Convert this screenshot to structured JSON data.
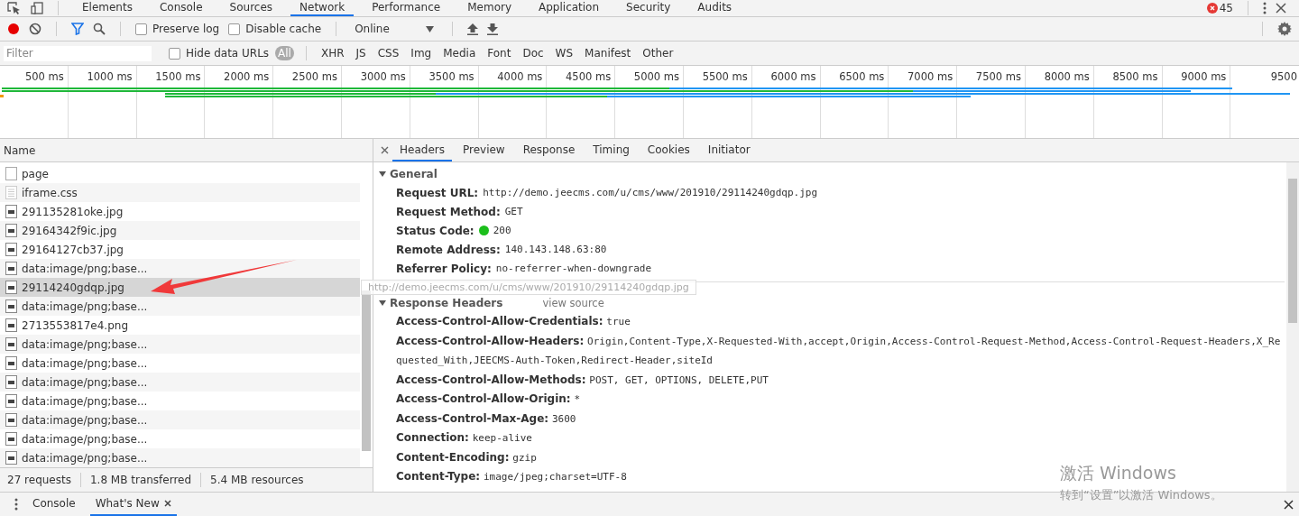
{
  "panel_tabs": [
    {
      "label": "Elements",
      "selected": false
    },
    {
      "label": "Console",
      "selected": false
    },
    {
      "label": "Sources",
      "selected": false
    },
    {
      "label": "Network",
      "selected": true
    },
    {
      "label": "Performance",
      "selected": false
    },
    {
      "label": "Memory",
      "selected": false
    },
    {
      "label": "Application",
      "selected": false
    },
    {
      "label": "Security",
      "selected": false
    },
    {
      "label": "Audits",
      "selected": false
    }
  ],
  "error_count": "45",
  "toolbar": {
    "recording": true,
    "preserve_log": {
      "label": "Preserve log",
      "checked": false
    },
    "disable_cache": {
      "label": "Disable cache",
      "checked": false
    },
    "throttling": "Online"
  },
  "filter_bar": {
    "placeholder": "Filter",
    "hide_data_urls": {
      "label": "Hide data URLs",
      "checked": false
    },
    "types": [
      {
        "label": "All",
        "selected": true
      },
      {
        "label": "XHR",
        "selected": false
      },
      {
        "label": "JS",
        "selected": false
      },
      {
        "label": "CSS",
        "selected": false
      },
      {
        "label": "Img",
        "selected": false
      },
      {
        "label": "Media",
        "selected": false
      },
      {
        "label": "Font",
        "selected": false
      },
      {
        "label": "Doc",
        "selected": false
      },
      {
        "label": "WS",
        "selected": false
      },
      {
        "label": "Manifest",
        "selected": false
      },
      {
        "label": "Other",
        "selected": false
      }
    ]
  },
  "overview": {
    "ticks": [
      "500 ms",
      "1000 ms",
      "1500 ms",
      "2000 ms",
      "2500 ms",
      "3000 ms",
      "3500 ms",
      "4000 ms",
      "4500 ms",
      "5000 ms",
      "5500 ms",
      "6000 ms",
      "6500 ms",
      "7000 ms",
      "7500 ms",
      "8000 ms",
      "8500 ms",
      "9000 ms",
      "9500"
    ]
  },
  "requests": {
    "column": "Name",
    "rows": [
      {
        "name": "page",
        "kind": "blank",
        "selected": false
      },
      {
        "name": "iframe.css",
        "kind": "css",
        "selected": false
      },
      {
        "name": "291135281oke.jpg",
        "kind": "image",
        "selected": false
      },
      {
        "name": "29164342f9ic.jpg",
        "kind": "image",
        "selected": false
      },
      {
        "name": "29164127cb37.jpg",
        "kind": "image",
        "selected": false
      },
      {
        "name": "data:image/png;base...",
        "kind": "image",
        "selected": false
      },
      {
        "name": "29114240gdqp.jpg",
        "kind": "image",
        "selected": true
      },
      {
        "name": "data:image/png;base...",
        "kind": "image",
        "selected": false
      },
      {
        "name": "2713553817e4.png",
        "kind": "image",
        "selected": false
      },
      {
        "name": "data:image/png;base...",
        "kind": "image",
        "selected": false
      },
      {
        "name": "data:image/png;base...",
        "kind": "image",
        "selected": false
      },
      {
        "name": "data:image/png;base...",
        "kind": "image",
        "selected": false
      },
      {
        "name": "data:image/png;base...",
        "kind": "image",
        "selected": false
      },
      {
        "name": "data:image/png;base...",
        "kind": "image",
        "selected": false
      },
      {
        "name": "data:image/png;base...",
        "kind": "image",
        "selected": false
      },
      {
        "name": "data:image/png;base...",
        "kind": "image",
        "selected": false
      }
    ],
    "summary": [
      "27 requests",
      "1.8 MB transferred",
      "5.4 MB resources"
    ]
  },
  "detail_tabs": [
    {
      "label": "Headers",
      "selected": true
    },
    {
      "label": "Preview",
      "selected": false
    },
    {
      "label": "Response",
      "selected": false
    },
    {
      "label": "Timing",
      "selected": false
    },
    {
      "label": "Cookies",
      "selected": false
    },
    {
      "label": "Initiator",
      "selected": false
    }
  ],
  "general": {
    "title": "General",
    "expanded": true,
    "items": [
      {
        "key": "Request URL:",
        "value": "http://demo.jeecms.com/u/cms/www/201910/29114240gdqp.jpg"
      },
      {
        "key": "Request Method:",
        "value": "GET"
      },
      {
        "key": "Status Code:",
        "value": "200",
        "color": "#1cbf1c"
      },
      {
        "key": "Remote Address:",
        "value": "140.143.148.63:80"
      },
      {
        "key": "Referrer Policy:",
        "value": "no-referrer-when-downgrade"
      }
    ]
  },
  "response_headers": {
    "title": "Response Headers",
    "link": "view source",
    "expanded": true,
    "items": [
      {
        "key": "Access-Control-Allow-Credentials:",
        "value": "true"
      },
      {
        "key": "Access-Control-Allow-Headers:",
        "value": "Origin,Content-Type,X-Requested-With,accept,Origin,Access-Control-Request-Method,Access-Control-Request-Headers,X_Requested_With,JEECMS-Auth-Token,Redirect-Header,siteId"
      },
      {
        "key": "Access-Control-Allow-Methods:",
        "value": "POST, GET, OPTIONS, DELETE,PUT"
      },
      {
        "key": "Access-Control-Allow-Origin:",
        "value": "*"
      },
      {
        "key": "Access-Control-Max-Age:",
        "value": "3600"
      },
      {
        "key": "Connection:",
        "value": "keep-alive"
      },
      {
        "key": "Content-Encoding:",
        "value": "gzip"
      },
      {
        "key": "Content-Type:",
        "value": "image/jpeg;charset=UTF-8"
      }
    ]
  },
  "tooltip": "http://demo.jeecms.com/u/cms/www/201910/29114240gdqp.jpg",
  "drawer_tabs": [
    {
      "label": "Console",
      "selected": false,
      "closable": false
    },
    {
      "label": "What's New",
      "selected": true,
      "closable": true
    }
  ],
  "os_notice": {
    "title": "激活 Windows",
    "text": "转到“设置”以激活 Windows。"
  }
}
